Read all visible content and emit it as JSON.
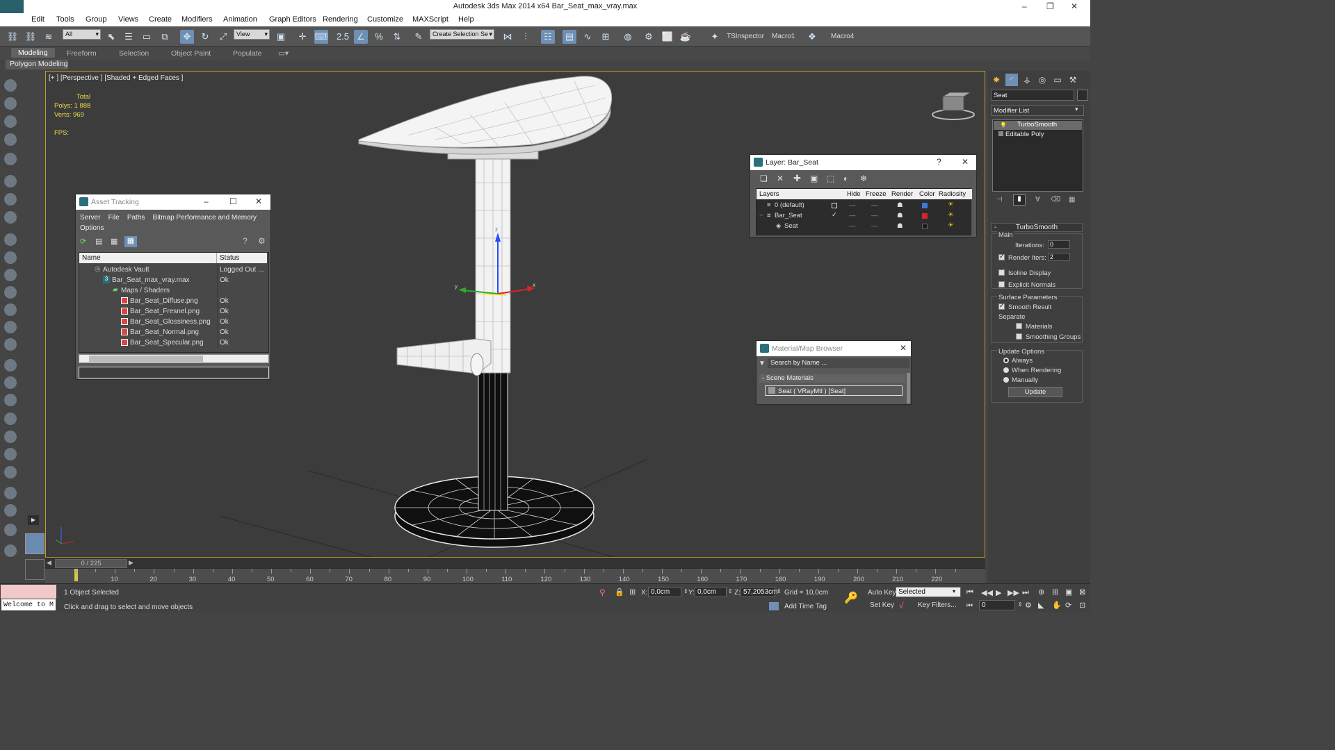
{
  "window": {
    "title": "Autodesk 3ds Max  2014 x64     Bar_Seat_max_vray.max",
    "minimize": "–",
    "maximize": "❐",
    "close": "✕"
  },
  "menu": [
    "Edit",
    "Tools",
    "Group",
    "Views",
    "Create",
    "Modifiers",
    "Animation",
    "Graph Editors",
    "Rendering",
    "Customize",
    "MAXScript",
    "Help"
  ],
  "toolbar": {
    "filter": "All",
    "coord": "View",
    "snap_value": "2.5",
    "selection_set": "Create Selection Se",
    "ts_inspector": "TSInspector",
    "macro1": "Macro1",
    "macro4": "Macro4"
  },
  "ribbon": {
    "tabs": [
      "Modeling",
      "Freeform",
      "Selection",
      "Object Paint",
      "Populate"
    ],
    "active": "Modeling",
    "sub": "Polygon Modeling"
  },
  "viewport": {
    "label": "[+ ] [Perspective ] [Shaded + Edged Faces ]",
    "stats_header": "Total",
    "polys_label": "Polys:",
    "polys": "1 888",
    "verts_label": "Verts:",
    "verts": "969",
    "fps_label": "FPS:",
    "axis_x": "x",
    "axis_y": "y",
    "axis_z": "z"
  },
  "asset_tracking": {
    "title": "Asset Tracking",
    "menu": [
      "Server",
      "File",
      "Paths",
      "Bitmap Performance and Memory"
    ],
    "menu2": "Options",
    "col_name": "Name",
    "col_status": "Status",
    "rows": [
      {
        "name": "Autodesk Vault",
        "status": "Logged Out ..."
      },
      {
        "name": "Bar_Seat_max_vray.max",
        "status": "Ok"
      },
      {
        "name": "Maps / Shaders",
        "status": ""
      },
      {
        "name": "Bar_Seat_Diffuse.png",
        "status": "Ok"
      },
      {
        "name": "Bar_Seat_Fresnel.png",
        "status": "Ok"
      },
      {
        "name": "Bar_Seat_Glossiness.png",
        "status": "Ok"
      },
      {
        "name": "Bar_Seat_Normal.png",
        "status": "Ok"
      },
      {
        "name": "Bar_Seat_Specular.png",
        "status": "Ok"
      }
    ]
  },
  "layer_dialog": {
    "title": "Layer: Bar_Seat",
    "help": "?",
    "close": "✕",
    "cols": [
      "Layers",
      "Hide",
      "Freeze",
      "Render",
      "Color",
      "Radiosity"
    ],
    "rows": [
      {
        "name": "0 (default)",
        "color": "#3a7bd5"
      },
      {
        "name": "Bar_Seat",
        "color": "#d42626"
      },
      {
        "name": "Seat",
        "color": "#1a1a1a"
      }
    ]
  },
  "material_browser": {
    "title": "Material/Map Browser",
    "search": "Search by Name ...",
    "group": "Scene Materials",
    "item": "Seat  ( VRayMtl )  [Seat]",
    "close": "✕"
  },
  "command_panel": {
    "object_name": "Seat",
    "modifier_list": "Modifier List",
    "stack": [
      "TurboSmooth",
      "Editable Poly"
    ],
    "turbosmooth": {
      "header": "TurboSmooth",
      "main": "Main",
      "iterations_label": "Iterations:",
      "iterations": "0",
      "render_iters_label": "Render Iters:",
      "render_iters": "2",
      "isoline": "Isoline Display",
      "explicit": "Explicit Normals",
      "surface": "Surface Parameters",
      "smooth": "Smooth Result",
      "separate": "Separate",
      "materials": "Materials",
      "smoothing": "Smoothing Groups",
      "update_options": "Update Options",
      "always": "Always",
      "when_rendering": "When Rendering",
      "manually": "Manually",
      "update_btn": "Update"
    }
  },
  "timeline": {
    "frame": "0 / 225",
    "ticks": [
      "10",
      "20",
      "30",
      "40",
      "50",
      "60",
      "70",
      "80",
      "90",
      "100",
      "110",
      "120",
      "130",
      "140",
      "150",
      "160",
      "170",
      "180",
      "190",
      "200",
      "210",
      "220"
    ]
  },
  "status": {
    "welcome": "Welcome to M",
    "selected": "1 Object Selected",
    "prompt": "Click and drag to select and move objects",
    "x_label": "X:",
    "x": "0,0cm",
    "y_label": "Y:",
    "y": "0,0cm",
    "z_label": "Z:",
    "z": "57,2053cm",
    "grid": "Grid = 10,0cm",
    "auto_key": "Auto Key",
    "selected_dd": "Selected",
    "set_key": "Set Key",
    "key_filters": "Key Filters...",
    "add_time_tag": "Add Time Tag",
    "frame_field": "0"
  }
}
